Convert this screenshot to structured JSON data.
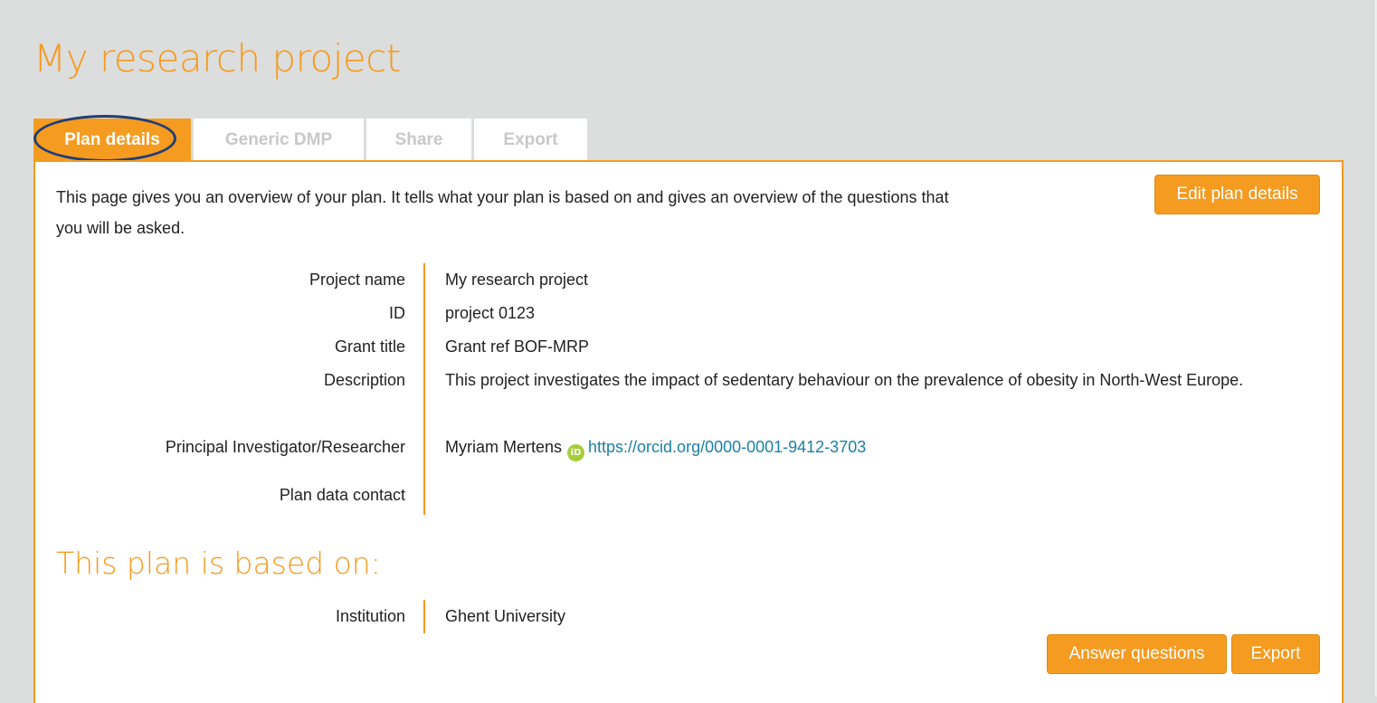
{
  "page": {
    "title": "My research project"
  },
  "tabs": [
    {
      "label": "Plan details",
      "active": true
    },
    {
      "label": "Generic DMP",
      "active": false
    },
    {
      "label": "Share",
      "active": false
    },
    {
      "label": "Export",
      "active": false
    }
  ],
  "intro": "This page gives you an overview of your plan. It tells what your plan is based on and gives an overview of the questions that you will be asked.",
  "buttons": {
    "edit_plan_details": "Edit plan details",
    "answer_questions": "Answer questions",
    "export": "Export"
  },
  "details": {
    "project_name": {
      "label": "Project name",
      "value": "My research project"
    },
    "id": {
      "label": "ID",
      "value": "project 0123"
    },
    "grant_title": {
      "label": "Grant title",
      "value": "Grant ref BOF-MRP"
    },
    "description": {
      "label": "Description",
      "value": "This project investigates the impact of sedentary behaviour on the prevalence of obesity in North-West Europe."
    },
    "principal_investigator": {
      "label": "Principal Investigator/Researcher",
      "name": "Myriam Mertens",
      "orcid_icon": "orcid-icon",
      "orcid_glyph": "iD",
      "orcid_url": "https://orcid.org/0000-0001-9412-3703"
    },
    "plan_data_contact": {
      "label": "Plan data contact",
      "value": ""
    }
  },
  "based_on": {
    "title": "This plan is based on:",
    "institution": {
      "label": "Institution",
      "value": "Ghent University"
    }
  },
  "colors": {
    "accent": "#f59b1f",
    "link": "#1c7fa6",
    "highlight": "#1f3e78",
    "background": "#dcdddd"
  }
}
